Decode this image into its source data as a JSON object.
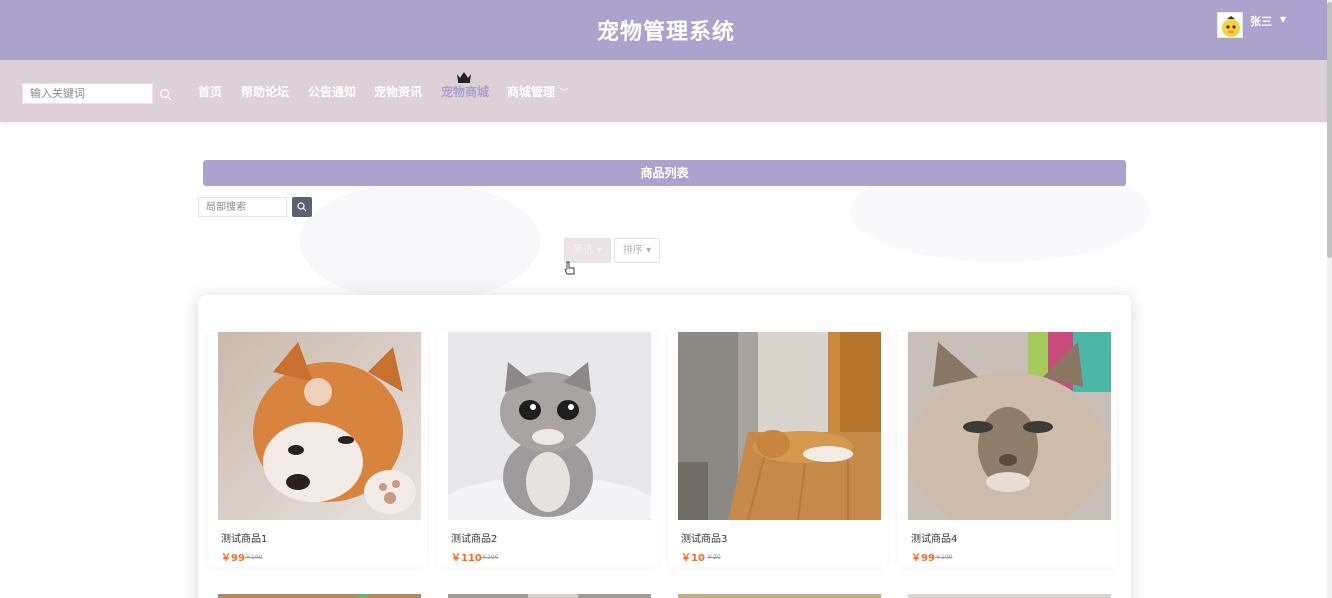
{
  "header": {
    "site_title": "宠物管理系统",
    "user_name": "张三",
    "user_menu_icon": "caret-down-icon",
    "brand_color": "#aba3ce"
  },
  "nav": {
    "search_placeholder": "输入关键词",
    "items": [
      {
        "label": "首页"
      },
      {
        "label": "帮助论坛"
      },
      {
        "label": "公告通知"
      },
      {
        "label": "宠物资讯"
      },
      {
        "label": "宠物商城",
        "active": true,
        "icon": "crown-icon"
      },
      {
        "label": "商城管理",
        "icon": "chevron-down-icon"
      }
    ],
    "background_color": "#ddd0d6"
  },
  "main": {
    "list_title": "商品列表",
    "local_search_placeholder": "局部搜索",
    "filter_button": "筛选",
    "sort_button": "排序"
  },
  "products": [
    {
      "name": "测试商品1",
      "price": "￥99",
      "original_price": "￥100",
      "image": "shiba-inu-in-snow"
    },
    {
      "name": "测试商品2",
      "price": "￥110",
      "original_price": "￥200",
      "image": "gray-tabby-kitten"
    },
    {
      "name": "测试商品3",
      "price": "￥10",
      "original_price": "￥20",
      "image": "dog-lying-on-floor"
    },
    {
      "name": "测试商品4",
      "price": "￥99",
      "original_price": "￥100",
      "image": "siamese-cat"
    }
  ],
  "colors": {
    "price": "#ff6a1e",
    "search_button": "#5a6170"
  }
}
